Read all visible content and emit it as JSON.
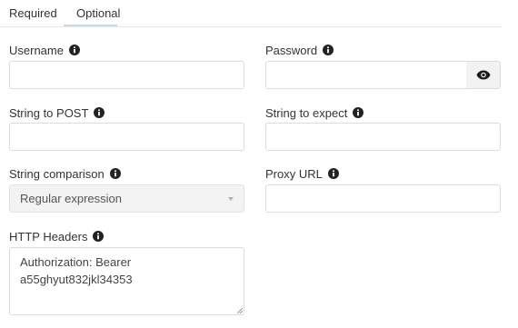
{
  "tabs": [
    {
      "label": "Required",
      "active": false
    },
    {
      "label": "Optional",
      "active": true
    }
  ],
  "fields": {
    "username": {
      "label": "Username",
      "value": ""
    },
    "password": {
      "label": "Password",
      "value": ""
    },
    "string_to_post": {
      "label": "String to POST",
      "value": ""
    },
    "string_to_expect": {
      "label": "String to expect",
      "value": ""
    },
    "string_comparison": {
      "label": "String comparison",
      "selected": "Regular expression"
    },
    "proxy_url": {
      "label": "Proxy URL",
      "value": ""
    },
    "http_headers": {
      "label": "HTTP Headers",
      "value": "Authorization: Bearer\na55ghyut832jkl34353"
    }
  },
  "icons": {
    "info": "info-icon",
    "password_toggle": "eye-icon"
  },
  "colors": {
    "tab_underline": "#c9d6e6",
    "input_border": "#dcdcdc",
    "select_background": "#f3f3f3",
    "eye_button_background": "#f2f2f2"
  }
}
